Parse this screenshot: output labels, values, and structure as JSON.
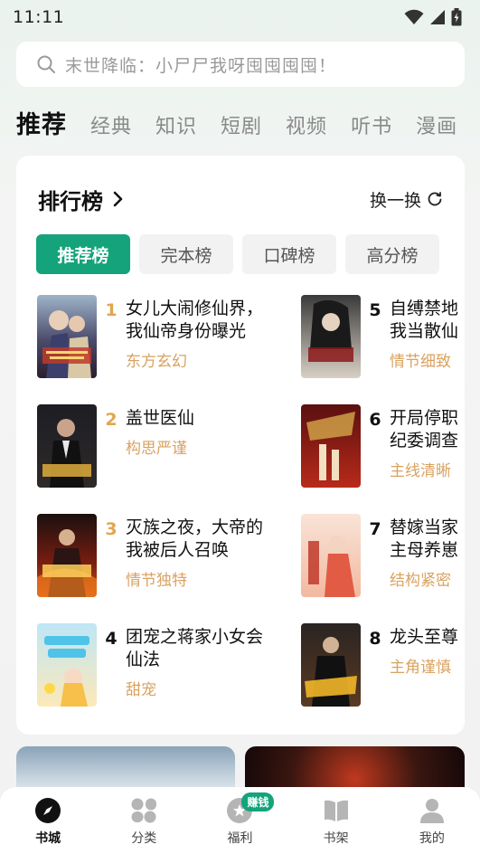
{
  "status": {
    "time": "11:11"
  },
  "search": {
    "placeholder": "末世降临：小尸尸我呀囤囤囤囤！"
  },
  "tabs": [
    {
      "label": "推荐",
      "active": true
    },
    {
      "label": "经典"
    },
    {
      "label": "知识"
    },
    {
      "label": "短剧"
    },
    {
      "label": "视频"
    },
    {
      "label": "听书"
    },
    {
      "label": "漫画"
    }
  ],
  "ranking": {
    "title": "排行榜",
    "refresh": "换一换",
    "chips": [
      {
        "label": "推荐榜",
        "active": true
      },
      {
        "label": "完本榜"
      },
      {
        "label": "口碑榜"
      },
      {
        "label": "高分榜"
      }
    ],
    "books": [
      {
        "rank": "1",
        "title": "女儿大闹修仙界，\n我仙帝身份曝光",
        "tag": "东方玄幻"
      },
      {
        "rank": "2",
        "title": "盖世医仙",
        "tag": "构思严谨"
      },
      {
        "rank": "3",
        "title": "灭族之夜，大帝的\n我被后人召唤",
        "tag": "情节独特"
      },
      {
        "rank": "4",
        "title": "团宠之蒋家小女会\n仙法",
        "tag": "甜宠"
      },
      {
        "rank": "5",
        "title": "自缚禁地\n我当散仙",
        "tag": "情节细致"
      },
      {
        "rank": "6",
        "title": "开局停职\n纪委调查",
        "tag": "主线清晰"
      },
      {
        "rank": "7",
        "title": "替嫁当家\n主母养崽",
        "tag": "结构紧密"
      },
      {
        "rank": "8",
        "title": "龙头至尊",
        "tag": "主角谨慎"
      }
    ]
  },
  "nav": [
    {
      "label": "书城",
      "icon": "compass-icon",
      "active": true
    },
    {
      "label": "分类",
      "icon": "grid-icon"
    },
    {
      "label": "福利",
      "icon": "gift-icon",
      "badge": "赚钱"
    },
    {
      "label": "书架",
      "icon": "book-icon"
    },
    {
      "label": "我的",
      "icon": "person-icon"
    }
  ],
  "colors": {
    "accent": "#14a37a",
    "rank_gold": "#e0a650",
    "tag": "#d9a261"
  }
}
